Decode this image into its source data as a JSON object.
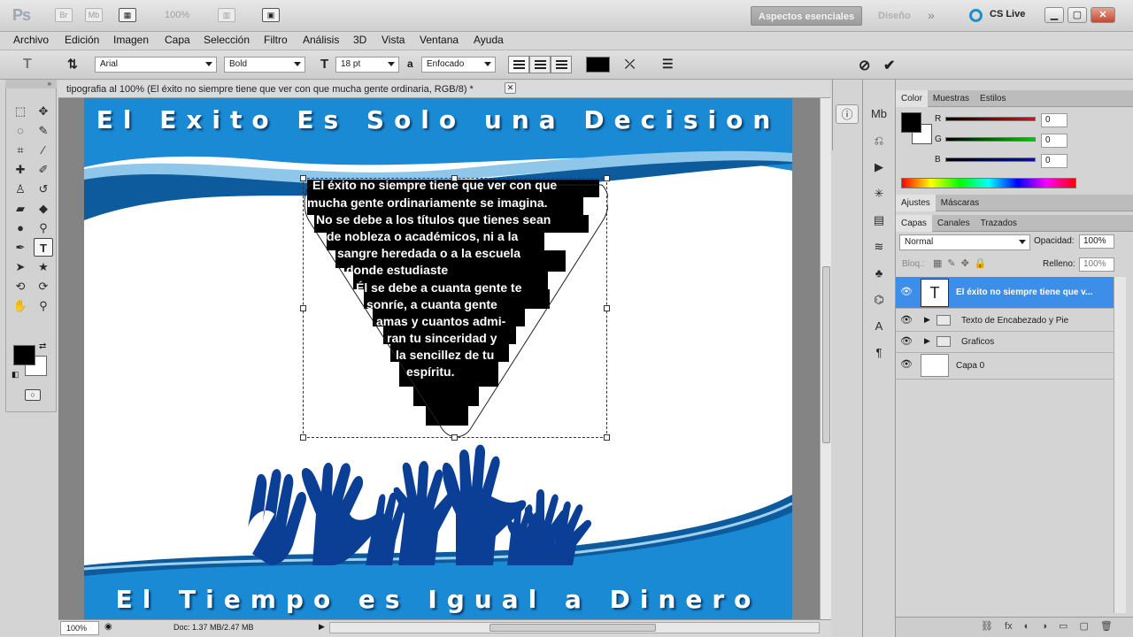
{
  "app": {
    "logo": "Ps",
    "zoom_display": "100%"
  },
  "workspace": {
    "active": "Aspectos esenciales",
    "other": "Diseño",
    "cslive": "CS Live"
  },
  "menu": [
    "Archivo",
    "Edición",
    "Imagen",
    "Capa",
    "Selección",
    "Filtro",
    "Análisis",
    "3D",
    "Vista",
    "Ventana",
    "Ayuda"
  ],
  "options": {
    "font_family": "Arial",
    "font_style": "Bold",
    "font_size": "18 pt",
    "antialias_label": "a",
    "antialias_value": "Enfocado",
    "color": "#000000"
  },
  "document": {
    "tab_title": "tipografia al 100% (El éxito no siempre tiene que ver con que mucha gente ordinaria, RGB/8) *",
    "header_text": "El Exito Es Solo una Decision",
    "footer_text": "El Tiempo es Igual a Dinero",
    "paragraph_lines": [
      "El éxito no siempre tiene que ver con que",
      "mucha gente ordinariamente se imagina.",
      "No se debe a los títulos que tienes sean",
      "de nobleza o académicos, ni a la",
      "sangre heredada o a la escuela",
      "donde estudiaste",
      "Él  se debe a cuanta gente te",
      "sonríe, a cuanta gente",
      "amas y cuantos admi-",
      "ran tu sinceridad y",
      "la sencillez de tu",
      "espíritu."
    ],
    "accent_color": "#1a8ad4"
  },
  "status": {
    "zoom": "100%",
    "doc_info": "Doc: 1.37 MB/2.47 MB"
  },
  "color_panel": {
    "tabs": [
      "Color",
      "Muestras",
      "Estilos"
    ],
    "r_label": "R",
    "g_label": "G",
    "b_label": "B",
    "r": "0",
    "g": "0",
    "b": "0"
  },
  "adjust_tabs": [
    "Ajustes",
    "Máscaras"
  ],
  "layers_panel": {
    "tabs": [
      "Capas",
      "Canales",
      "Trazados"
    ],
    "blend_mode": "Normal",
    "opacity_label": "Opacidad:",
    "opacity": "100%",
    "lock_label": "Bloq.:",
    "fill_label": "Relleno:",
    "fill": "100%",
    "layers": [
      {
        "name": "El éxito no siempre tiene que v...",
        "type": "text",
        "selected": true
      },
      {
        "name": "Texto de Encabezado y Pie",
        "type": "group",
        "selected": false
      },
      {
        "name": "Graficos",
        "type": "group",
        "selected": false
      },
      {
        "name": "Capa 0",
        "type": "pixel",
        "selected": false
      }
    ]
  }
}
